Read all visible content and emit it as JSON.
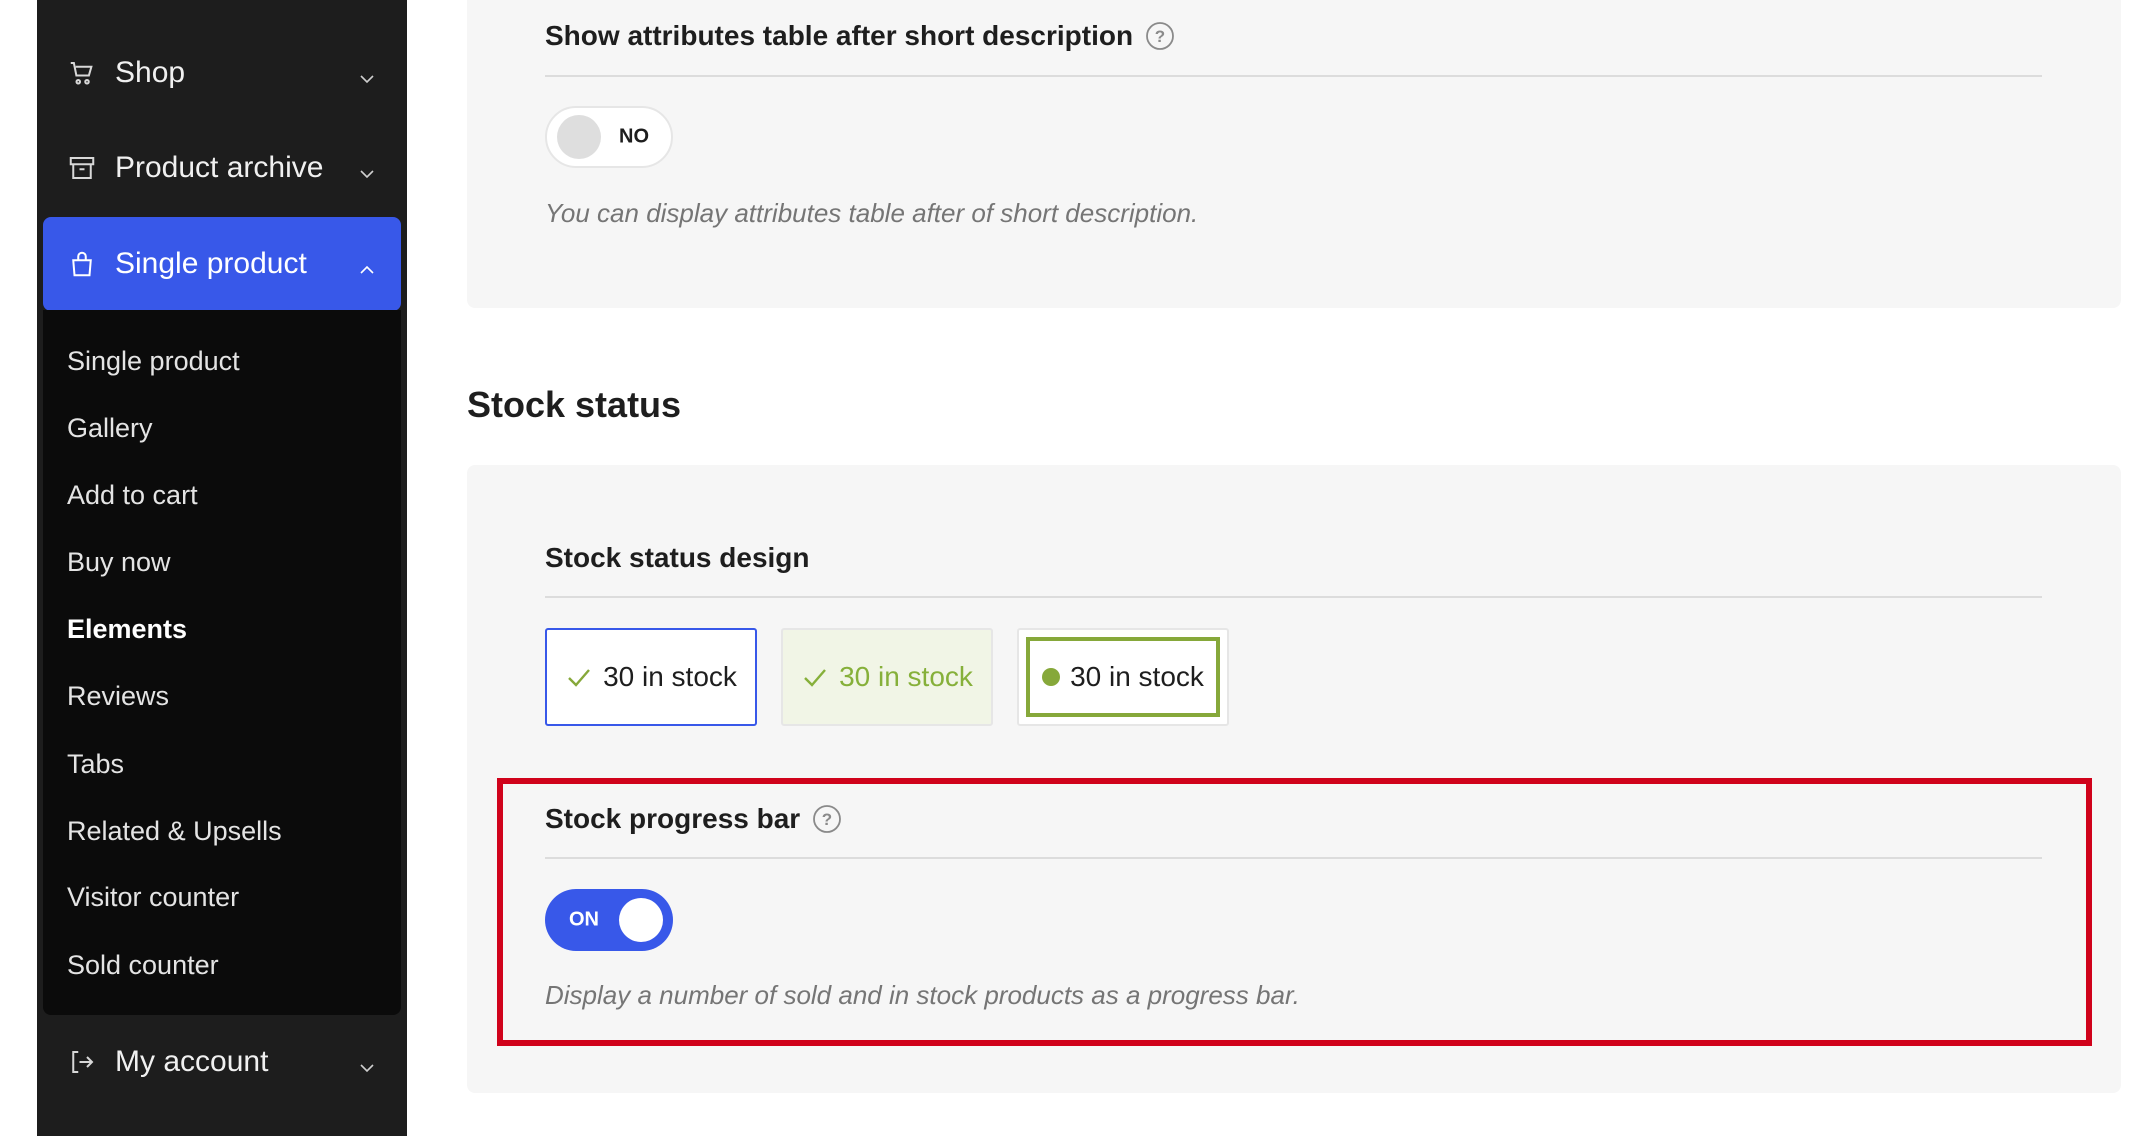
{
  "sidebar": {
    "top_items": [
      {
        "label": "Shop",
        "icon": "cart-icon"
      },
      {
        "label": "Product archive",
        "icon": "archive-icon"
      }
    ],
    "active_item": {
      "label": "Single product",
      "icon": "bag-icon"
    },
    "submenu": [
      "Single product",
      "Gallery",
      "Add to cart",
      "Buy now",
      "Elements",
      "Reviews",
      "Tabs",
      "Related & Upsells",
      "Visitor counter",
      "Sold counter"
    ],
    "current_submenu_item": "Elements",
    "bottom_item": {
      "label": "My account",
      "icon": "logout-icon"
    }
  },
  "attributes_setting": {
    "title": "Show attributes table after short description",
    "toggle_label": "NO",
    "toggle_on": false,
    "description": "You can display attributes table after of short description."
  },
  "stock_section": {
    "title": "Stock status",
    "design": {
      "title": "Stock status design",
      "options": [
        "30 in stock",
        "30 in stock",
        "30 in stock"
      ],
      "selected_index": 0
    },
    "progress_bar": {
      "title": "Stock progress bar",
      "toggle_label": "ON",
      "toggle_on": true,
      "description": "Display a number of sold and in stock products as a progress bar."
    }
  },
  "colors": {
    "accent": "#3858e9",
    "sidebar_bg": "#1d1d1d",
    "stock_green": "#86a83a",
    "highlight_red": "#d0021b"
  }
}
